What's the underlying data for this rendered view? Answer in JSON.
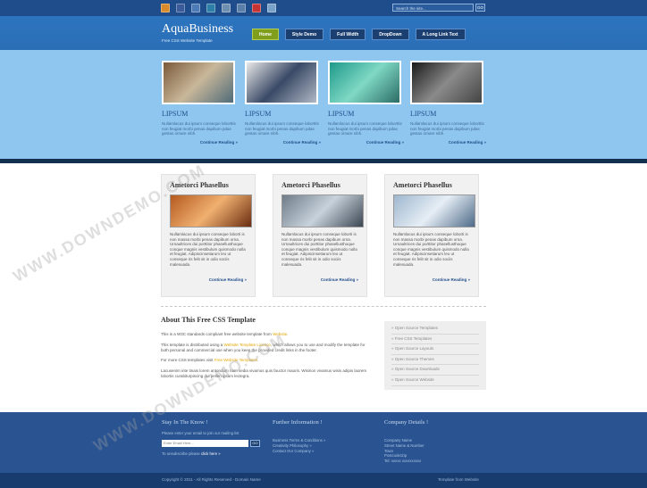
{
  "social_icons": [
    {
      "name": "rss-icon",
      "color": "#d98a2b"
    },
    {
      "name": "facebook-icon",
      "color": "#3b5b9a"
    },
    {
      "name": "delicious-icon",
      "color": "#4d7bb5"
    },
    {
      "name": "linkedin-icon",
      "color": "#2e7fa8"
    },
    {
      "name": "email-icon",
      "color": "#6f8fb1"
    },
    {
      "name": "share-icon",
      "color": "#5a7fa8"
    },
    {
      "name": "youtube-icon",
      "color": "#c53333"
    },
    {
      "name": "phone-icon",
      "color": "#7aa2c8"
    }
  ],
  "search": {
    "placeholder": "Search the site...",
    "button": "GO"
  },
  "header": {
    "logo": "AquaBusiness",
    "tagline": "Free CSS Website Template"
  },
  "nav": [
    "Home",
    "Style Demo",
    "Full Width",
    "DropDown",
    "A Long Link Text"
  ],
  "featured": [
    {
      "title": "LIPSUM",
      "text": "Nullamlacus dui ipsum conseque loborttis non feugiat morbi penas dapibum pdas gestas ornare nibh.",
      "more": "Continue Reading »",
      "img": "venice-canal-image",
      "colors": [
        "#7a5a3a",
        "#c9b79a",
        "#4f6b78"
      ]
    },
    {
      "title": "LIPSUM",
      "text": "Nullamlacus dui ipsum conseque loborttis non feugiat morbi penas dapibum pdas gestas ornare nibh.",
      "more": "Continue Reading »",
      "img": "business-meeting-image",
      "colors": [
        "#e8e8e8",
        "#3a4a66",
        "#b0b8c4"
      ]
    },
    {
      "title": "LIPSUM",
      "text": "Nullamlacus dui ipsum conseque loborttis non feugiat morbi penas dapibum pdas gestas ornare nibh.",
      "more": "Continue Reading »",
      "img": "aqua-pipes-image",
      "colors": [
        "#1f9a8a",
        "#7fd8c4",
        "#2b6c66"
      ]
    },
    {
      "title": "LIPSUM",
      "text": "Nullamlacus dui ipsum conseque loborttis non feugiat morbi penas dapibum pdas gestas ornare nibh.",
      "more": "Continue Reading »",
      "img": "black-rose-image",
      "colors": [
        "#1a1a1a",
        "#8a8a8a",
        "#444444"
      ]
    }
  ],
  "boxes": [
    {
      "title": "Ametorci Phasellus",
      "img": "orange-corridor-image",
      "colors": [
        "#b55a1f",
        "#f0b070",
        "#6a2d10"
      ],
      "text": "Nullamlacus dui ipsum conseque loborti is non massa morbi penas dapibum orna. Urnaultrices dui porttitor phasellusthoque conque magnis vestibulum quismodo nulla et feugiat. Adipiscinsetiarum leo ut conseque ris felit sit in odio sociis malesuada.",
      "more": "Continue Reading »"
    },
    {
      "title": "Ametorci Phasellus",
      "img": "building-street-image",
      "colors": [
        "#6f7c88",
        "#c7d2dc",
        "#3c4652"
      ],
      "text": "Nullamlacus dui ipsum conseque loborti is non massa morbi penas dapibum orna. Urnaultrices dui porttitor phasellusthoque conque magnis vestibulum quismodo nulla et feugiat. Adipiscinsetiarum leo ut conseque ris felit sit in odio sociis malesuada.",
      "more": "Continue Reading »"
    },
    {
      "title": "Ametorci Phasellus",
      "img": "glass-tower-image",
      "colors": [
        "#9fb7cf",
        "#e6eef5",
        "#4e6a88"
      ],
      "text": "Nullamlacus dui ipsum conseque loborti is non massa morbi penas dapibum orna. Urnaultrices dui porttitor phasellusthoque conque magnis vestibulum quismodo nulla et feugiat. Adipiscinsetiarum leo ut conseque ris felit sit in odio sociis malesuada.",
      "more": "Continue Reading »"
    }
  ],
  "about": {
    "title": "About This Free CSS Template",
    "p1_a": "This is a W3C standards compliant free website template from ",
    "p1_link": "Website",
    "p1_b": ".",
    "p2_a": "This template is distributed using a ",
    "p2_link": "Website Template Licence",
    "p2_b": ", which allows you to use and modify the template for both personal and commercial use when you keep the provided credit links in the footer.",
    "p3_a": "For more CSS templates visit ",
    "p3_link": "Free Website Templates",
    "p3_b": ".",
    "p4": "Lacusenim inte tinais lorem antondum nam sedia vivamus quis fauctor mauris. Wisinon vivamus wisis adipis laorem lobortis curabiturpiscing dui pellen ipsum lectegra."
  },
  "sidebar": [
    "Open Source Templates",
    "Free CSS Templates",
    "Open Source Layouts",
    "Open Source Themes",
    "Open Source Downloads",
    "Open Source Website"
  ],
  "footer": {
    "col1": {
      "title": "Stay In The Know !",
      "text": "Please enter your email to join our mailing list",
      "input": "Enter Email Here...",
      "button": "GO",
      "unsub_a": "To unsubscribe please ",
      "unsub_link": "click here »"
    },
    "col2": {
      "title": "Further Information !",
      "links": [
        "Business Terms & Conditions »",
        "Creativity Philosophy »",
        "Contact Our Company »"
      ]
    },
    "col3": {
      "title": "Company Details !",
      "lines": [
        "Company Name",
        "Street Name & Number",
        "Town",
        "Postcode/Zip",
        "Tel: xxxxx xxxxxxxxxx"
      ]
    }
  },
  "bottom": {
    "copyright": "Copyright © 2011 - All Rights Reserved - Domain Name",
    "credit": "Template from Website"
  },
  "watermark": "WWW.DOWNDEMO.COM"
}
